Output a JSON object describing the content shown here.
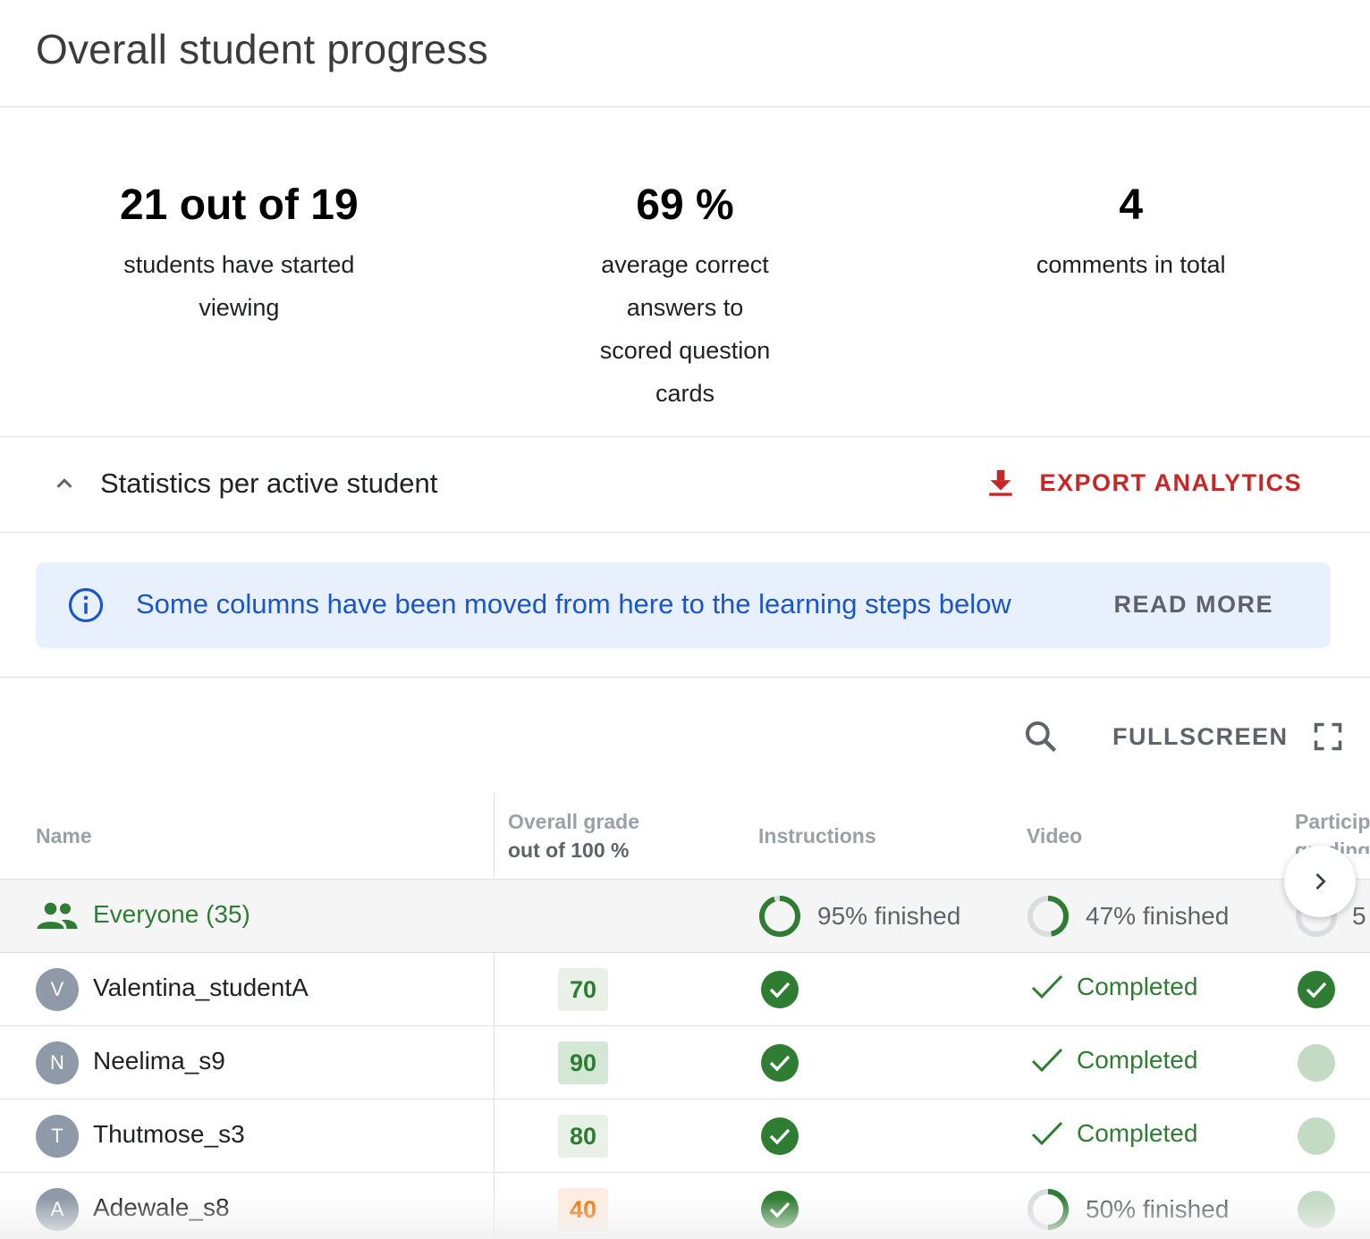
{
  "page": {
    "title": "Overall student progress"
  },
  "stats": [
    {
      "value": "21 out of 19",
      "label": "students have started viewing"
    },
    {
      "value": "69 %",
      "label": "average correct answers to scored question cards"
    },
    {
      "value": "4",
      "label": "comments in total"
    }
  ],
  "section": {
    "title": "Statistics per active student",
    "export_label": "EXPORT ANALYTICS"
  },
  "banner": {
    "text": "Some columns have been moved from here to the learning steps below",
    "read_more": "READ MORE"
  },
  "toolbar": {
    "fullscreen_label": "FULLSCREEN"
  },
  "table": {
    "headers": {
      "name": "Name",
      "grade_line1": "Overall grade",
      "grade_line2": "out of 100 %",
      "instructions": "Instructions",
      "video": "Video",
      "participation_line1": "Particip",
      "participation_line2": "grading"
    },
    "everyone": {
      "label": "Everyone (35)",
      "instructions": "95% finished",
      "instructions_fraction": 0.95,
      "video": "47% finished",
      "video_fraction": 0.47,
      "participation_partial": "5"
    },
    "rows": [
      {
        "initial": "V",
        "name": "Valentina_studentA",
        "grade": "70",
        "video": "Completed"
      },
      {
        "initial": "N",
        "name": "Neelima_s9",
        "grade": "90",
        "video": "Completed"
      },
      {
        "initial": "T",
        "name": "Thutmose_s3",
        "grade": "80",
        "video": "Completed"
      },
      {
        "initial": "A",
        "name": "Adewale_s8",
        "grade": "40",
        "video": "50% finished",
        "video_fraction": 0.5
      }
    ]
  },
  "colors": {
    "accent_green": "#2e7d32",
    "export_red": "#c62828",
    "banner_blue": "#1a56c7",
    "grade_low": "#e8710a"
  },
  "icons": [
    "chevron-up-icon",
    "download-icon",
    "info-icon",
    "search-icon",
    "fullscreen-icon",
    "people-icon",
    "check-circle-icon",
    "check-icon",
    "chevron-right-icon"
  ]
}
